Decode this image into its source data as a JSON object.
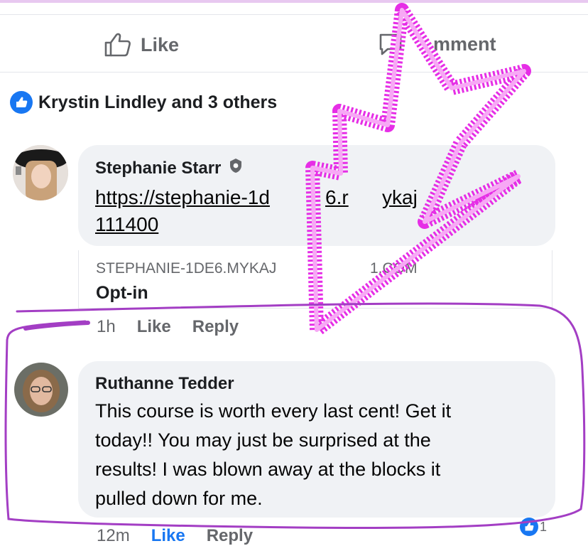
{
  "actions": {
    "like_label": "Like",
    "comment_label": "mment"
  },
  "reactions": {
    "summary": "Krystin Lindley and 3 others"
  },
  "comments": [
    {
      "author": "Stephanie Starr",
      "link_line1": "https://stephanie-1d",
      "link_line2": "111400",
      "link_fragment_mid": "6.r",
      "link_fragment_right": "ykaj",
      "preview_domain": "STEPHANIE-1DE6.MYKAJ",
      "preview_domain_tail": "1.COM",
      "preview_title": "Opt-in",
      "time": "1h",
      "like_label": "Like",
      "reply_label": "Reply"
    },
    {
      "author": "Ruthanne Tedder",
      "text_lines": [
        "This course is worth every last cent! Get it",
        "today!! You may just be surprised at the",
        "results! I was blown away at the blocks it",
        "pulled down for me."
      ],
      "time": "12m",
      "like_label": "Like",
      "reply_label": "Reply",
      "reaction_count": "1"
    }
  ],
  "colors": {
    "accent": "#1877f2",
    "annotation_magenta": "#e62ee6",
    "annotation_purple": "#a33ec4"
  },
  "icons": [
    "thumbs-up-icon",
    "comment-icon",
    "like-reaction-icon",
    "verified-badge-icon"
  ]
}
